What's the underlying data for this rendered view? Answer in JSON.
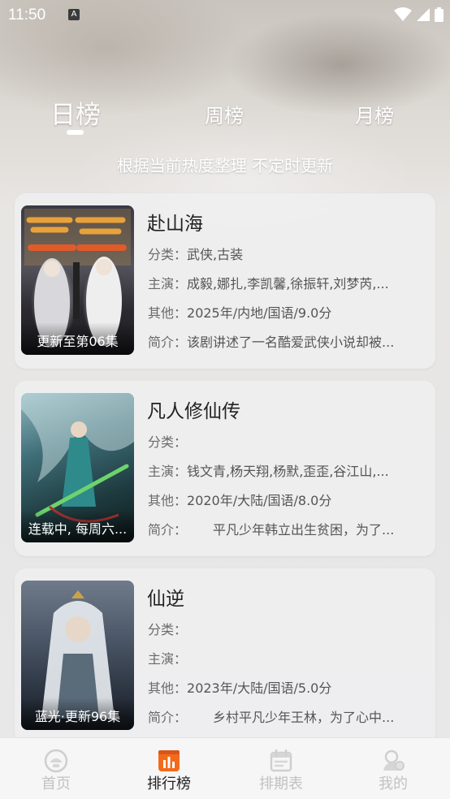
{
  "status_bar": {
    "time": "11:50",
    "badge": "A"
  },
  "tabs": [
    {
      "label": "日榜",
      "active": true
    },
    {
      "label": "周榜",
      "active": false
    },
    {
      "label": "月榜",
      "active": false
    }
  ],
  "subtitle": "根据当前热度整理 不定时更新",
  "cards": [
    {
      "title": "赴山海",
      "poster_caption": "更新至第06集",
      "category_label": "分类：",
      "category": "武侠,古装",
      "cast_label": "主演：",
      "cast": "成毅,娜扎,李凯馨,徐振轩,刘梦芮,...",
      "other_label": "其他：",
      "other": "2025年/内地/国语/9.0分",
      "intro_label": "简介：",
      "intro": "该剧讲述了一名酷爱武侠小说却被..."
    },
    {
      "title": "凡人修仙传",
      "poster_caption": "连载中, 每周六...",
      "category_label": "分类：",
      "category": "",
      "cast_label": "主演：",
      "cast": "钱文青,杨天翔,杨默,歪歪,谷江山,...",
      "other_label": "其他：",
      "other": "2020年/大陆/国语/8.0分",
      "intro_label": "简介：",
      "intro": "　　平凡少年韩立出生贫困，为了..."
    },
    {
      "title": "仙逆",
      "poster_caption": "蓝光·更新96集",
      "category_label": "分类：",
      "category": "",
      "cast_label": "主演：",
      "cast": "",
      "other_label": "其他：",
      "other": "2023年/大陆/国语/5.0分",
      "intro_label": "简介：",
      "intro": "　　乡村平凡少年王林，为了心中..."
    }
  ],
  "bottom_nav": [
    {
      "label": "首页",
      "icon": "home-icon",
      "active": false
    },
    {
      "label": "排行榜",
      "icon": "ranking-icon",
      "active": true
    },
    {
      "label": "排期表",
      "icon": "calendar-icon",
      "active": false
    },
    {
      "label": "我的",
      "icon": "profile-icon",
      "active": false
    }
  ],
  "colors": {
    "accent": "#f26b1d",
    "inactive_nav": "#c2c2c2",
    "text_dark": "#222222"
  }
}
